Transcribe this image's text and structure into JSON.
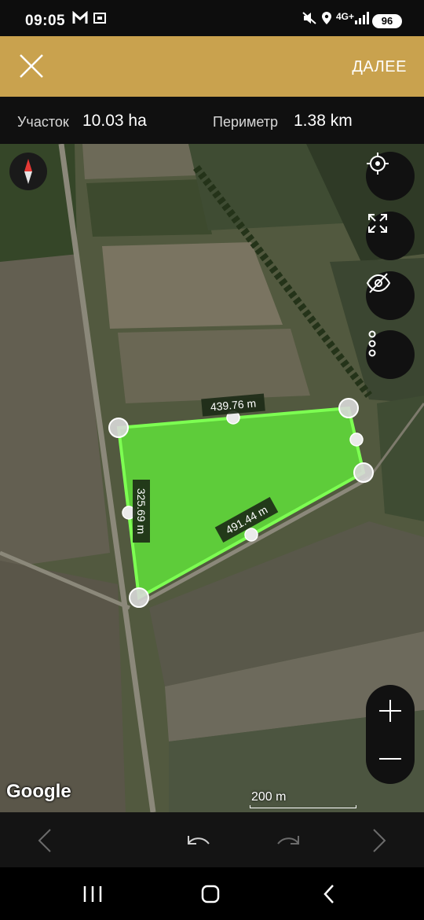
{
  "status_bar": {
    "time": "09:05",
    "network": "4G+",
    "battery": "96"
  },
  "header": {
    "close_icon": "close-icon",
    "next_label": "ДАЛЕЕ"
  },
  "stats": {
    "area_label": "Участок",
    "area_value": "10.03 ha",
    "perimeter_label": "Периметр",
    "perimeter_value": "1.38 km"
  },
  "map": {
    "polygon_fill": "#5fd63a",
    "polygon_stroke": "#7dff52",
    "edges": [
      "439.76 m",
      "325.69 m",
      "491.44 m"
    ],
    "attribution": "Google",
    "scale_label": "200 m"
  },
  "map_controls": [
    "compass-icon",
    "my-location-icon",
    "fullscreen-icon",
    "visibility-off-icon",
    "more-vert-icon",
    "zoom-in-icon",
    "zoom-out-icon"
  ],
  "toolbar": [
    "previous-icon",
    "undo-icon",
    "redo-icon",
    "next-icon"
  ],
  "nav_bar": [
    "recents-icon",
    "home-icon",
    "back-icon"
  ],
  "colors": {
    "header_bg": "#c9a24e",
    "info_bg": "#121212"
  }
}
